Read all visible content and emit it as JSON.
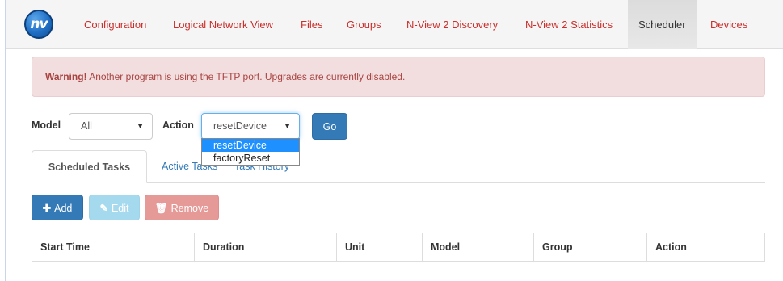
{
  "nav": {
    "logo_text": "nv",
    "items": [
      {
        "label": "Configuration"
      },
      {
        "label": "Logical Network View"
      },
      {
        "label": "Files"
      },
      {
        "label": "Groups"
      },
      {
        "label": "N-View 2 Discovery"
      },
      {
        "label": "N-View 2 Statistics"
      },
      {
        "label": "Scheduler",
        "active": true
      },
      {
        "label": "Devices"
      }
    ]
  },
  "alert": {
    "strong": "Warning!",
    "message": " Another program is using the TFTP port. Upgrades are currently disabled."
  },
  "filters": {
    "model_label": "Model",
    "model_value": "All",
    "action_label": "Action",
    "action_value": "resetDevice",
    "action_options": [
      "resetDevice",
      "factoryReset"
    ],
    "go_label": "Go"
  },
  "tabs": [
    {
      "label": "Scheduled Tasks",
      "active": true
    },
    {
      "label": "Active Tasks"
    },
    {
      "label": "Task History"
    }
  ],
  "toolbar": {
    "add_label": "Add",
    "edit_label": "Edit",
    "remove_label": "Remove"
  },
  "table": {
    "columns": [
      "Start Time",
      "Duration",
      "Unit",
      "Model",
      "Group",
      "Action"
    ]
  },
  "colors": {
    "nav_link": "#c9302c",
    "primary": "#337ab7",
    "alert_bg": "#f2dede",
    "alert_text": "#a94442"
  }
}
